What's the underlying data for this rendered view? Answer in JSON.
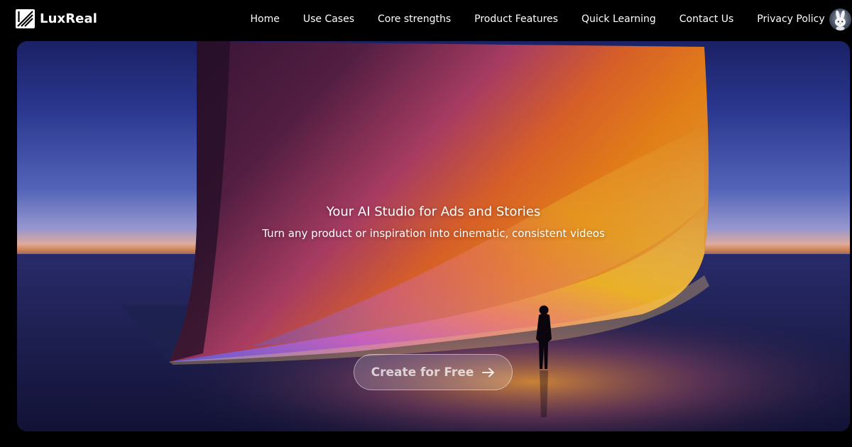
{
  "brand": {
    "name": "LuxReal",
    "logo_icon": "luxreal-logo-icon"
  },
  "nav": {
    "items": [
      {
        "label": "Home"
      },
      {
        "label": "Use Cases"
      },
      {
        "label": "Core strengths"
      },
      {
        "label": "Product Features"
      },
      {
        "label": "Quick Learning"
      },
      {
        "label": "Contact Us"
      },
      {
        "label": "Privacy Policy"
      }
    ],
    "avatar_icon": "rabbit-avatar-icon"
  },
  "hero": {
    "title": "Your AI Studio for Ads and Stories",
    "subtitle": "Turn any product or inspiration into cinematic, consistent videos",
    "cta_label": "Create for Free",
    "cta_icon": "arrow-right-icon"
  },
  "colors": {
    "background": "#000000",
    "text": "#ffffff",
    "sky_top": "#1d246e",
    "horizon_glow": "#f2b9a9",
    "curtain_orange": "#f07a1e",
    "curtain_pink": "#e87ad6",
    "curtain_yellow": "#f6c12a"
  }
}
